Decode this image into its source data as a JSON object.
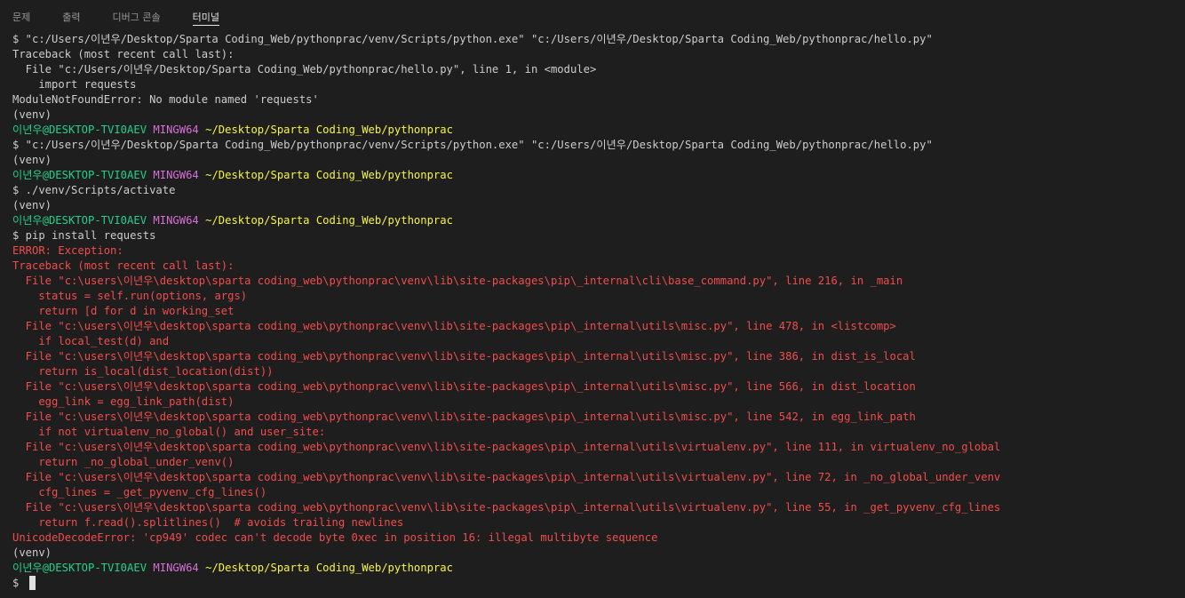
{
  "tabs": [
    {
      "label": "문제",
      "active": false
    },
    {
      "label": "출력",
      "active": false
    },
    {
      "label": "디버그 콘솔",
      "active": false
    },
    {
      "label": "터미널",
      "active": true
    }
  ],
  "terminal": {
    "lines": [
      {
        "text": "$ \"c:/Users/이년우/Desktop/Sparta Coding_Web/pythonprac/venv/Scripts/python.exe\" \"c:/Users/이년우/Desktop/Sparta Coding_Web/pythonprac/hello.py\""
      },
      {
        "text": "Traceback (most recent call last):"
      },
      {
        "text": "  File \"c:/Users/이년우/Desktop/Sparta Coding_Web/pythonprac/hello.py\", line 1, in <module>"
      },
      {
        "text": "    import requests"
      },
      {
        "text": "ModuleNotFoundError: No module named 'requests'"
      },
      {
        "text": "(venv)"
      },
      {
        "prompt": {
          "user": "이년우@DESKTOP-TVI0AEV",
          "shell": "MINGW64",
          "path": "~/Desktop/Sparta Coding_Web/pythonprac"
        }
      },
      {
        "text": "$ \"c:/Users/이년우/Desktop/Sparta Coding_Web/pythonprac/venv/Scripts/python.exe\" \"c:/Users/이년우/Desktop/Sparta Coding_Web/pythonprac/hello.py\""
      },
      {
        "text": "(venv)"
      },
      {
        "prompt": {
          "user": "이년우@DESKTOP-TVI0AEV",
          "shell": "MINGW64",
          "path": "~/Desktop/Sparta Coding_Web/pythonprac"
        }
      },
      {
        "text": "$ ./venv/Scripts/activate"
      },
      {
        "text": "(venv)"
      },
      {
        "prompt": {
          "user": "이년우@DESKTOP-TVI0AEV",
          "shell": "MINGW64",
          "path": "~/Desktop/Sparta Coding_Web/pythonprac"
        }
      },
      {
        "text": "$ pip install requests"
      },
      {
        "text": "ERROR: Exception:",
        "error": true
      },
      {
        "text": "Traceback (most recent call last):",
        "error": true
      },
      {
        "text": "  File \"c:\\users\\이년우\\desktop\\sparta coding_web\\pythonprac\\venv\\lib\\site-packages\\pip\\_internal\\cli\\base_command.py\", line 216, in _main",
        "error": true
      },
      {
        "text": "    status = self.run(options, args)",
        "error": true
      },
      {
        "text": "    return [d for d in working_set",
        "error": true
      },
      {
        "text": "  File \"c:\\users\\이년우\\desktop\\sparta coding_web\\pythonprac\\venv\\lib\\site-packages\\pip\\_internal\\utils\\misc.py\", line 478, in <listcomp>",
        "error": true
      },
      {
        "text": "    if local_test(d) and",
        "error": true
      },
      {
        "text": "  File \"c:\\users\\이년우\\desktop\\sparta coding_web\\pythonprac\\venv\\lib\\site-packages\\pip\\_internal\\utils\\misc.py\", line 386, in dist_is_local",
        "error": true
      },
      {
        "text": "    return is_local(dist_location(dist))",
        "error": true
      },
      {
        "text": "  File \"c:\\users\\이년우\\desktop\\sparta coding_web\\pythonprac\\venv\\lib\\site-packages\\pip\\_internal\\utils\\misc.py\", line 566, in dist_location",
        "error": true
      },
      {
        "text": "    egg_link = egg_link_path(dist)",
        "error": true
      },
      {
        "text": "  File \"c:\\users\\이년우\\desktop\\sparta coding_web\\pythonprac\\venv\\lib\\site-packages\\pip\\_internal\\utils\\misc.py\", line 542, in egg_link_path",
        "error": true
      },
      {
        "text": "    if not virtualenv_no_global() and user_site:",
        "error": true
      },
      {
        "text": "  File \"c:\\users\\이년우\\desktop\\sparta coding_web\\pythonprac\\venv\\lib\\site-packages\\pip\\_internal\\utils\\virtualenv.py\", line 111, in virtualenv_no_global",
        "error": true
      },
      {
        "text": "    return _no_global_under_venv()",
        "error": true
      },
      {
        "text": "  File \"c:\\users\\이년우\\desktop\\sparta coding_web\\pythonprac\\venv\\lib\\site-packages\\pip\\_internal\\utils\\virtualenv.py\", line 72, in _no_global_under_venv",
        "error": true
      },
      {
        "text": "    cfg_lines = _get_pyvenv_cfg_lines()",
        "error": true
      },
      {
        "text": "  File \"c:\\users\\이년우\\desktop\\sparta coding_web\\pythonprac\\venv\\lib\\site-packages\\pip\\_internal\\utils\\virtualenv.py\", line 55, in _get_pyvenv_cfg_lines",
        "error": true
      },
      {
        "text": "    return f.read().splitlines()  # avoids trailing newlines",
        "error": true
      },
      {
        "text": "UnicodeDecodeError: 'cp949' codec can't decode byte 0xec in position 16: illegal multibyte sequence",
        "error": true
      },
      {
        "text": "(venv)"
      },
      {
        "prompt": {
          "user": "이년우@DESKTOP-TVI0AEV",
          "shell": "MINGW64",
          "path": "~/Desktop/Sparta Coding_Web/pythonprac"
        }
      },
      {
        "text": "$ ",
        "cursor": true
      }
    ]
  }
}
